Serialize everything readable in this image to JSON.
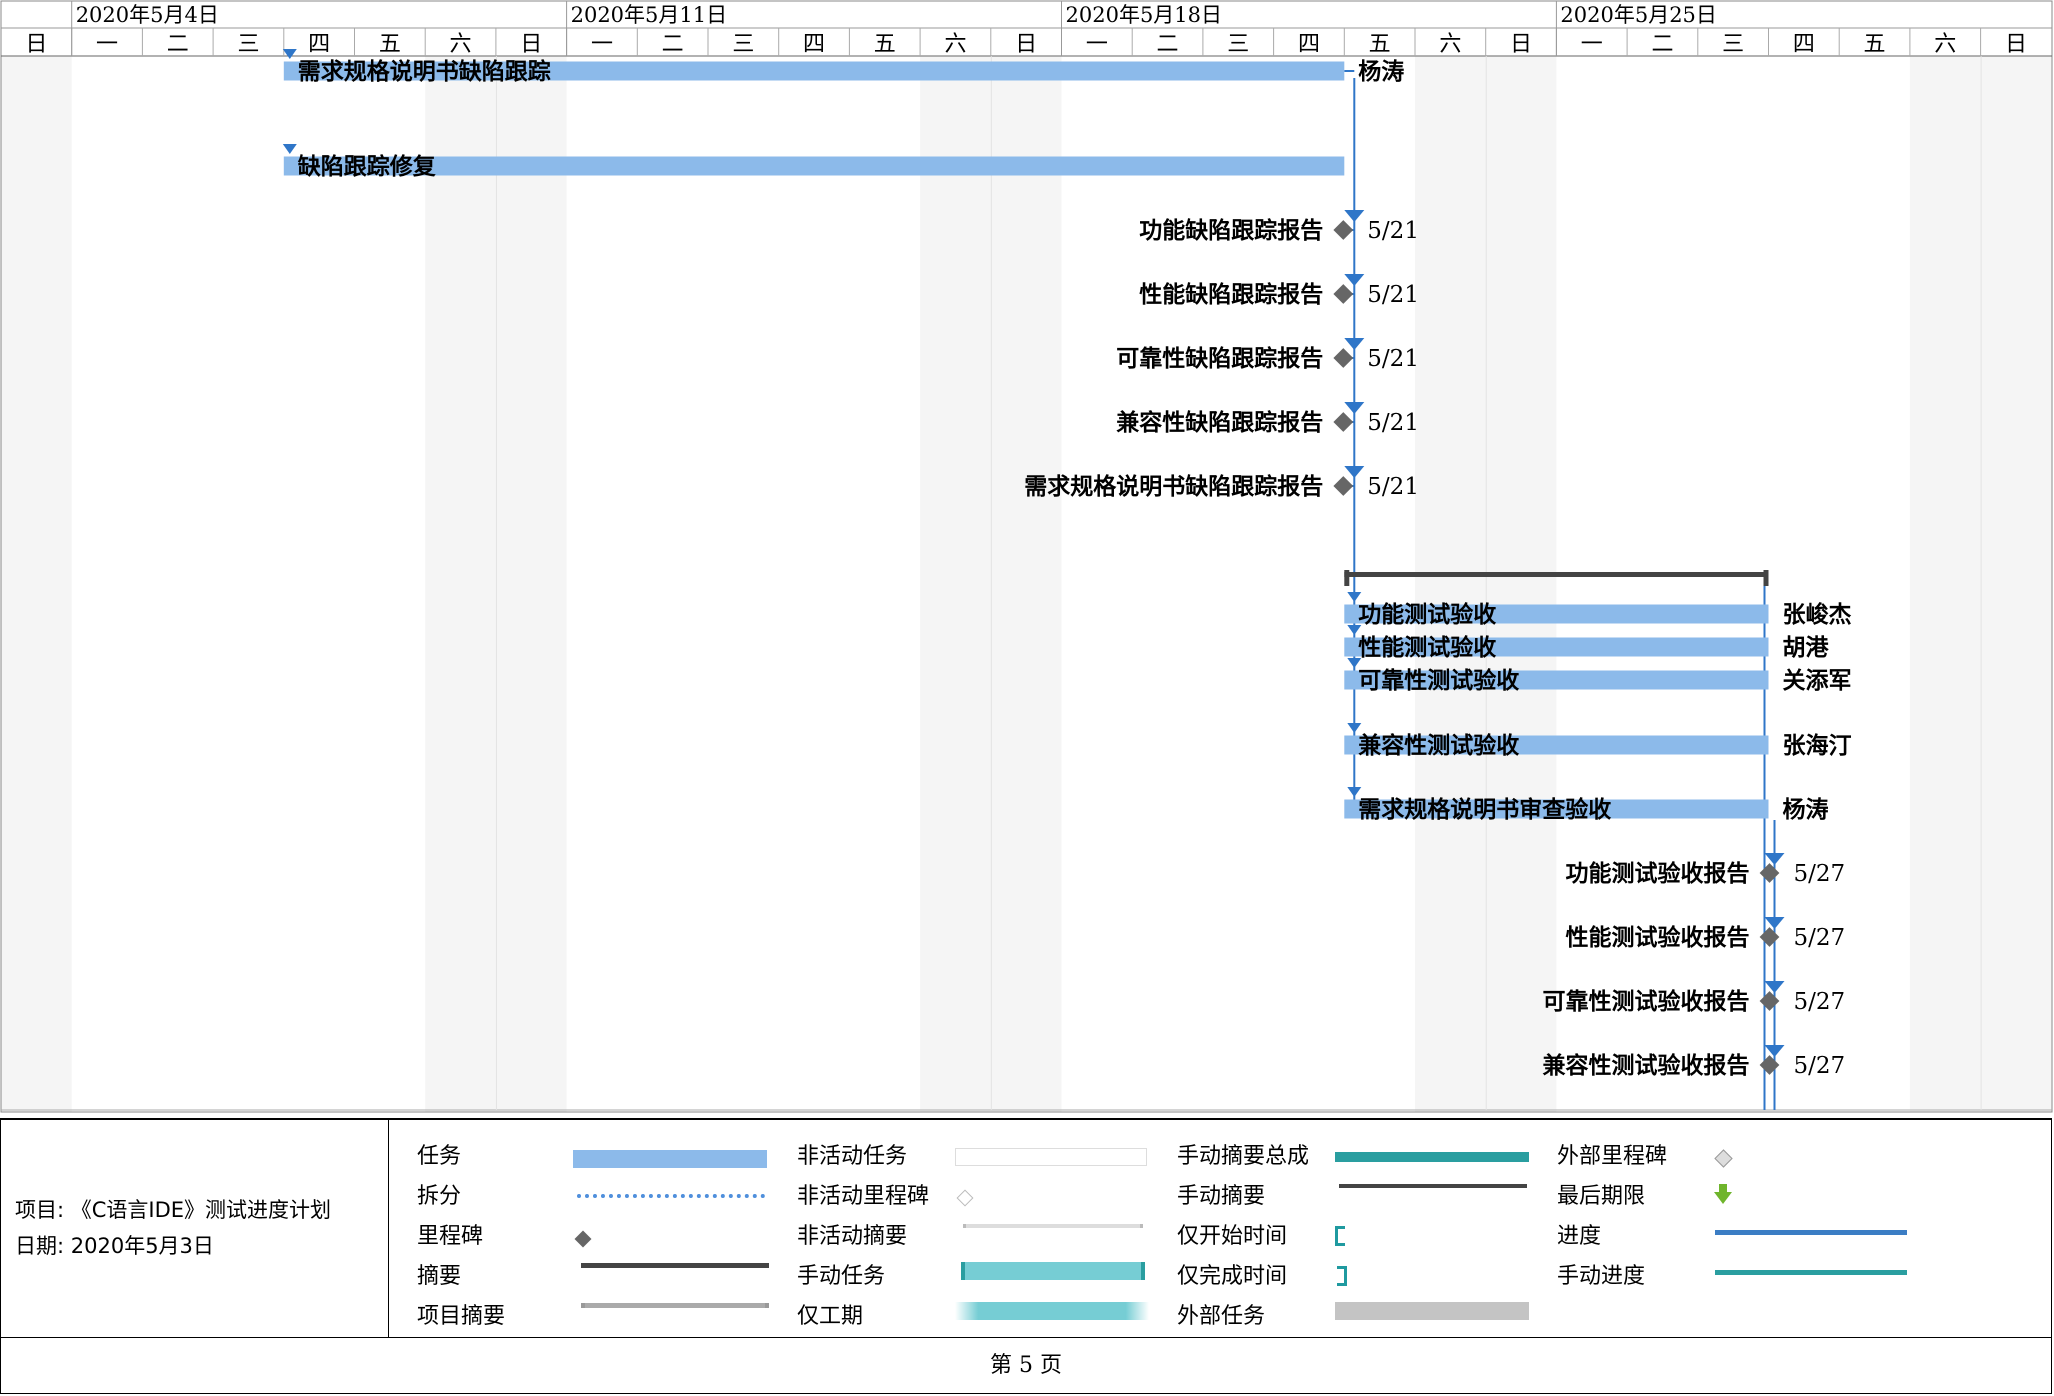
{
  "timeline": {
    "week_labels": [
      "2020年5月4日",
      "2020年5月11日",
      "2020年5月18日",
      "2020年5月25日"
    ],
    "day_labels": [
      "日",
      "一",
      "二",
      "三",
      "四",
      "五",
      "六",
      "日",
      "一",
      "二",
      "三",
      "四",
      "五",
      "六",
      "日",
      "一",
      "二",
      "三",
      "四",
      "五",
      "六",
      "日",
      "一",
      "二",
      "三",
      "四",
      "五",
      "六",
      "日"
    ]
  },
  "tasks": [
    {
      "kind": "bar",
      "label": "需求规格说明书缺陷跟踪",
      "resource": "杨涛"
    },
    {
      "kind": "bar",
      "label": "缺陷跟踪修复",
      "resource": ""
    },
    {
      "kind": "milestone",
      "label": "功能缺陷跟踪报告",
      "date": "5/21"
    },
    {
      "kind": "milestone",
      "label": "性能缺陷跟踪报告",
      "date": "5/21"
    },
    {
      "kind": "milestone",
      "label": "可靠性缺陷跟踪报告",
      "date": "5/21"
    },
    {
      "kind": "milestone",
      "label": "兼容性缺陷跟踪报告",
      "date": "5/21"
    },
    {
      "kind": "milestone",
      "label": "需求规格说明书缺陷跟踪报告",
      "date": "5/21"
    },
    {
      "kind": "bar",
      "label": "功能测试验收",
      "resource": "张峻杰"
    },
    {
      "kind": "bar",
      "label": "性能测试验收",
      "resource": "胡港"
    },
    {
      "kind": "bar",
      "label": "可靠性测试验收",
      "resource": "关添军"
    },
    {
      "kind": "bar",
      "label": "兼容性测试验收",
      "resource": "张海汀"
    },
    {
      "kind": "bar",
      "label": "需求规格说明书审查验收",
      "resource": "杨涛"
    },
    {
      "kind": "milestone",
      "label": "功能测试验收报告",
      "date": "5/27"
    },
    {
      "kind": "milestone",
      "label": "性能测试验收报告",
      "date": "5/27"
    },
    {
      "kind": "milestone",
      "label": "可靠性测试验收报告",
      "date": "5/27"
    },
    {
      "kind": "milestone",
      "label": "兼容性测试验收报告",
      "date": "5/27"
    }
  ],
  "project_info": {
    "project": "项目: 《C语言IDE》测试进度计划",
    "date": "日期: 2020年5月3日"
  },
  "legend": {
    "col1": [
      "任务",
      "拆分",
      "里程碑",
      "摘要",
      "项目摘要"
    ],
    "col2": [
      "非活动任务",
      "非活动里程碑",
      "非活动摘要",
      "手动任务",
      "仅工期"
    ],
    "col3": [
      "手动摘要总成",
      "手动摘要",
      "仅开始时间",
      "仅完成时间",
      "外部任务"
    ],
    "col4": [
      "外部里程碑",
      "最后期限",
      "进度",
      "手动进度"
    ]
  },
  "colors": {
    "task_bar": "#8cbaea",
    "link": "#2f76c8",
    "milestone": "#666666",
    "summary": "#444444",
    "weekend_shade": "#f5f5f5",
    "manual_task": "#76cdd4",
    "manual_summary_rollup": "#2a9ea0",
    "progress": "#3b7dc4",
    "deadline": "#6fb52c"
  },
  "footer": {
    "page_label": "第 5 页"
  }
}
